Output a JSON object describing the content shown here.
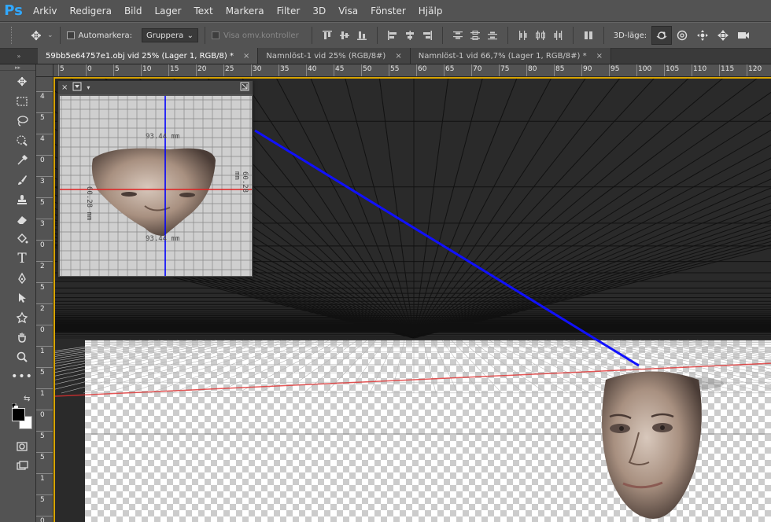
{
  "app": {
    "logo": "Ps"
  },
  "menu": [
    "Arkiv",
    "Redigera",
    "Bild",
    "Lager",
    "Text",
    "Markera",
    "Filter",
    "3D",
    "Visa",
    "Fönster",
    "Hjälp"
  ],
  "options": {
    "tool_icon": "move-icon",
    "auto_select_label": "Automarkera:",
    "group_select_value": "Gruppera",
    "show_transform_label": "Visa omv.kontroller",
    "mode_3d_label": "3D-läge:",
    "mode_3d_icons": [
      "orbit-icon",
      "roll-icon",
      "pan-icon",
      "slide-icon",
      "camera-icon"
    ]
  },
  "tabs": [
    {
      "label": "59bb5e64757e1.obj vid 25% (Lager 1, RGB/8) *",
      "active": true
    },
    {
      "label": "Namnlöst-1 vid 25% (RGB/8#)",
      "active": false
    },
    {
      "label": "Namnlöst-1 vid 66,7% (Lager 1, RGB/8#) *",
      "active": false
    }
  ],
  "ruler_h": [
    "5",
    "0",
    "5",
    "10",
    "15",
    "20",
    "25",
    "30",
    "35",
    "40",
    "45",
    "50",
    "55",
    "60",
    "65",
    "70",
    "75",
    "80",
    "85",
    "90",
    "95",
    "100",
    "105",
    "110",
    "115",
    "120"
  ],
  "ruler_v": [
    "4",
    "5",
    "4",
    "0",
    "3",
    "5",
    "3",
    "0",
    "2",
    "5",
    "2",
    "0",
    "1",
    "5",
    "1",
    "0",
    "5",
    "5",
    "1",
    "5",
    "0"
  ],
  "colors": {
    "foreground": "#000000",
    "background": "#ffffff",
    "accent": "#31a8ff",
    "axis_x": "#e02020",
    "axis_y": "#0000ff"
  },
  "miniview": {
    "dim_top": "93.44 mm",
    "dim_bottom": "93.44 mm",
    "dim_left": "60.28 mm",
    "dim_right": "60.28 mm"
  }
}
